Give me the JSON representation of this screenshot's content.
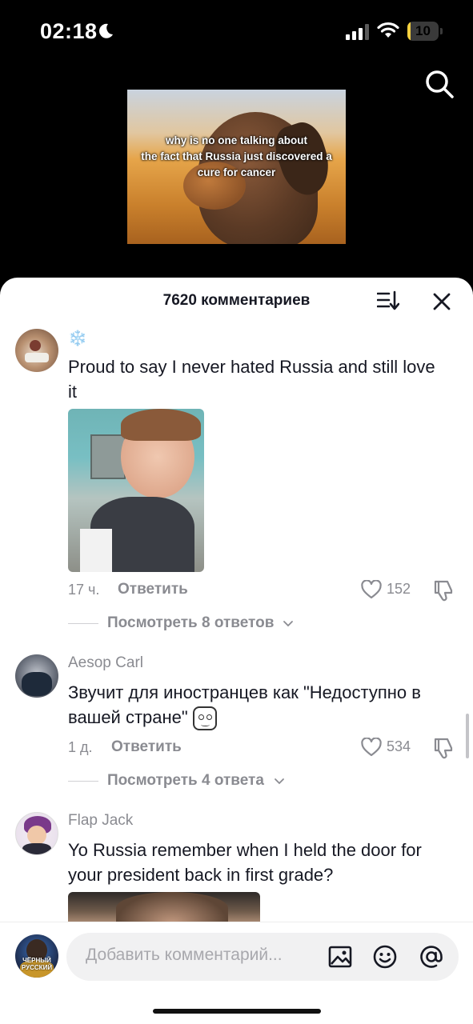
{
  "status_bar": {
    "time": "02:18",
    "battery_percent": 10,
    "battery_label": "10",
    "battery_color": "#f4d03f",
    "signal_icon": "signal-icon",
    "wifi_icon": "wifi-icon",
    "focus_icon": "moon-icon"
  },
  "video": {
    "caption_line1": "why is no one talking about",
    "caption_line2": "the fact that Russia just discovered a",
    "caption_line3": "cure for cancer"
  },
  "sheet": {
    "title": "7620 комментариев",
    "sort_icon": "sort-icon",
    "close_icon": "close-icon"
  },
  "comments": [
    {
      "username": "",
      "username_emoji": "❄️",
      "text": "Proud to say I never hated Russia and still love it",
      "time": "17 ч.",
      "reply_label": "Ответить",
      "likes": "152",
      "replies_label": "Посмотреть 8 ответов"
    },
    {
      "username": "Aesop Carl",
      "text": "Звучит для иностранцев как \"Недоступно в вашей стране\"",
      "time": "1 д.",
      "reply_label": "Ответить",
      "likes": "534",
      "replies_label": "Посмотреть 4 ответа"
    },
    {
      "username": "Flap Jack",
      "text": "Yo Russia remember when I held the door for your president back in first grade?"
    }
  ],
  "input": {
    "placeholder": "Добавить комментарий...",
    "user_avatar_text": "ЧЁРНЫЙ РУССКИЙ",
    "icons": [
      "image-icon",
      "emoji-icon",
      "mention-icon"
    ]
  }
}
